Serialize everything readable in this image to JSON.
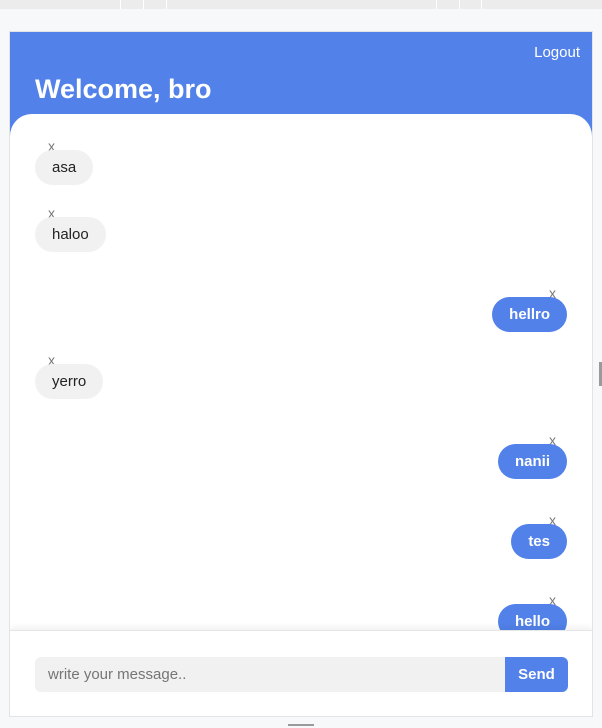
{
  "header": {
    "logout_label": "Logout",
    "welcome_text": "Welcome, bro"
  },
  "colors": {
    "accent": "#5181e9",
    "incoming_bubble": "#f1f1f1"
  },
  "messages": [
    {
      "direction": "incoming",
      "text": "asa",
      "delete_label": "x"
    },
    {
      "direction": "incoming",
      "text": "haloo",
      "delete_label": "x"
    },
    {
      "direction": "outgoing",
      "text": "hellro",
      "delete_label": "x"
    },
    {
      "direction": "incoming",
      "text": "yerro",
      "delete_label": "x"
    },
    {
      "direction": "outgoing",
      "text": "nanii",
      "delete_label": "x"
    },
    {
      "direction": "outgoing",
      "text": "tes",
      "delete_label": "x"
    },
    {
      "direction": "outgoing",
      "text": "hello",
      "delete_label": "x"
    }
  ],
  "composer": {
    "placeholder": "write your message..",
    "send_label": "Send"
  }
}
